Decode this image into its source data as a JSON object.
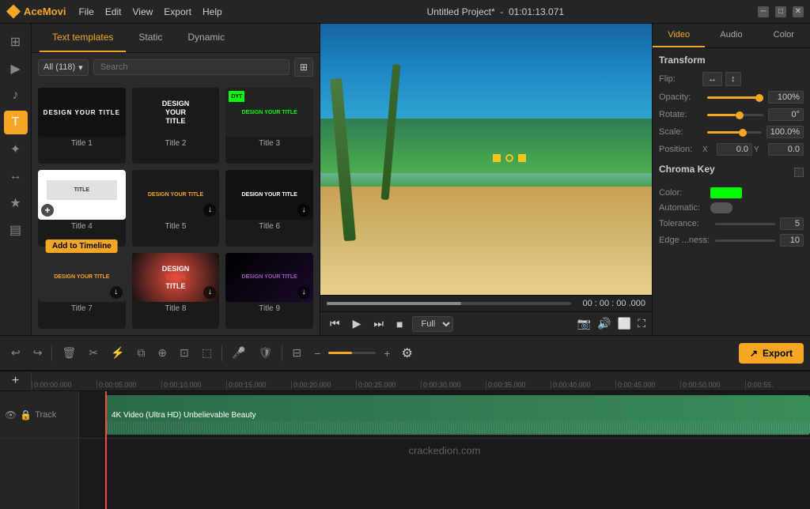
{
  "app": {
    "name": "AceMovi",
    "title": "Untitled Project*",
    "timecode_total": "01:01:13.071"
  },
  "menu": {
    "file": "File",
    "edit": "Edit",
    "view": "View",
    "export": "Export",
    "help": "Help"
  },
  "tabs": {
    "text_templates": "Text templates",
    "static": "Static",
    "dynamic": "Dynamic"
  },
  "filter": {
    "label": "All (118)",
    "search_placeholder": "Search"
  },
  "templates": [
    {
      "id": 1,
      "label": "Title 1",
      "text": "DESIGN YOUR TITLE",
      "bg": "#000",
      "color": "#fff"
    },
    {
      "id": 2,
      "label": "Title 2",
      "text": "DESIGN YOUR TITLE",
      "bg": "#111",
      "color": "#fff"
    },
    {
      "id": 3,
      "label": "Title 3",
      "text": "DESIGN YOUR TITLE",
      "bg": "#222",
      "color": "#0f0"
    },
    {
      "id": 4,
      "label": "Title 4",
      "text": "",
      "bg": "#fff",
      "color": "#000"
    },
    {
      "id": 5,
      "label": "Title 5",
      "text": "DESIGN YOUR TITLE",
      "bg": "#1a1a1a",
      "color": "#f5a623"
    },
    {
      "id": 6,
      "label": "Title 6",
      "text": "DESIGN YOUR TITLE",
      "bg": "#111",
      "color": "#fff"
    },
    {
      "id": 7,
      "label": "Title 7",
      "text": "DESIGN YOUR TITLE",
      "bg": "#2a2a2a",
      "color": "#f5a623"
    },
    {
      "id": 8,
      "label": "Title 8",
      "text": "DESIGN YOUR TITLE",
      "bg": "#111",
      "color": "#e74c3c"
    },
    {
      "id": 9,
      "label": "Title 9",
      "text": "DESIGN YOUR TITLE",
      "bg": "#000",
      "color": "#9b59b6"
    }
  ],
  "tooltip": "Add to Timeline",
  "right_panel": {
    "tabs": [
      "Video",
      "Audio",
      "Color"
    ],
    "active_tab": "Video",
    "transform": {
      "label": "Transform",
      "flip_label": "Flip:",
      "opacity_label": "Opacity:",
      "opacity_value": "100%",
      "opacity_pct": 100,
      "rotate_label": "Rotate:",
      "rotate_value": "0°",
      "rotate_pct": 0,
      "scale_label": "Scale:",
      "scale_value": "100.0%",
      "scale_pct": 60,
      "position_label": "Position:",
      "pos_x_label": "X",
      "pos_x_value": "0.0",
      "pos_y_label": "Y",
      "pos_y_value": "0.0"
    },
    "chroma": {
      "label": "Chroma Key",
      "color_label": "Color:",
      "automatic_label": "Automatic:",
      "tolerance_label": "Tolerance:",
      "tolerance_value": "5",
      "edge_label": "Edge ...ness:",
      "edge_value": "10"
    }
  },
  "playback": {
    "timecode": "00 : 00 : 00 .000",
    "quality": "Full"
  },
  "toolbar": {
    "export_label": "Export",
    "settings_label": "⚙"
  },
  "timeline": {
    "add_track": "+",
    "ruler_marks": [
      "0:00:00.000",
      "0:00:05.000",
      "0:00:10.000",
      "0:00:15.000",
      "0:00:20.000",
      "0:00:25.000",
      "0:00:30.000",
      "0:00:35.000",
      "0:00:40.000",
      "0:00:45.000",
      "0:00:50.000",
      "0:00:55."
    ],
    "track_label": "Track",
    "clip_label": "4K Video (Ultra HD) Unbelievable Beauty",
    "watermark": "crackedion.com"
  }
}
